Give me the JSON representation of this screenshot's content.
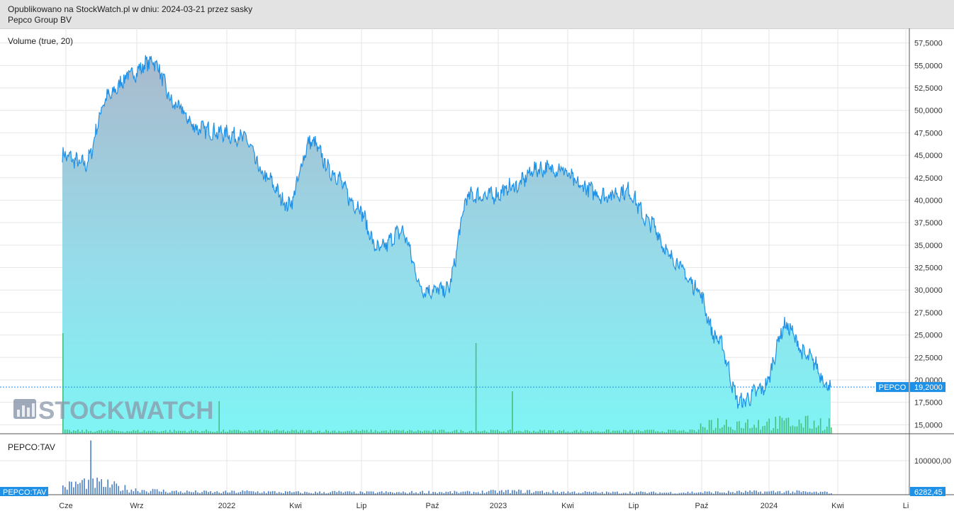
{
  "header": {
    "published_line": "Opublikowano na StockWatch.pl w dniu: 2024-03-21 przez sasky",
    "instrument": "Pepco Group BV"
  },
  "colors": {
    "price_line": "#1e90e6",
    "price_fill_top": "#a9b9cc",
    "price_fill_bottom": "#7ff4f4",
    "volume_bar": "#3db56a",
    "tav_bar": "#4a7fc1",
    "label_bg": "#1e90e6",
    "grid": "#e6e6e6"
  },
  "watermark": "STOCKWATCH",
  "chart_data": [
    {
      "type": "area",
      "indicator_label": "Volume (true, 20)",
      "series_label": "PEPCO",
      "last_value_label": "19,2000",
      "ylim": [
        14000,
        58500
      ],
      "y_ticks": [
        "57,5000",
        "55,0000",
        "52,5000",
        "50,0000",
        "47,5000",
        "45,0000",
        "42,5000",
        "40,0000",
        "37,5000",
        "35,0000",
        "32,5000",
        "30,0000",
        "27,5000",
        "25,0000",
        "22,5000",
        "20,0000",
        "17,5000",
        "15,0000"
      ],
      "x_ticks": [
        "Cze",
        "Wrz",
        "2022",
        "Kwi",
        "Lip",
        "Paź",
        "2023",
        "Kwi",
        "Lip",
        "Paź",
        "2024",
        "Kwi",
        "Li"
      ],
      "x": [
        "2021-05",
        "2021-06",
        "2021-07",
        "2021-08",
        "2021-09",
        "2021-10",
        "2021-11",
        "2021-12",
        "2022-01",
        "2022-02",
        "2022-03",
        "2022-04",
        "2022-05",
        "2022-06",
        "2022-07",
        "2022-08",
        "2022-09",
        "2022-10",
        "2022-11",
        "2022-12",
        "2023-01",
        "2023-02",
        "2023-03",
        "2023-04",
        "2023-05",
        "2023-06",
        "2023-07",
        "2023-08",
        "2023-09",
        "2023-10",
        "2023-11",
        "2023-12",
        "2024-01",
        "2024-02",
        "2024-03"
      ],
      "values": [
        45.0,
        44.0,
        51.5,
        54.0,
        55.5,
        50.5,
        48.0,
        47.5,
        47.0,
        42.5,
        39.5,
        46.5,
        43.0,
        39.5,
        34.5,
        36.5,
        30.0,
        30.0,
        40.5,
        40.5,
        41.5,
        43.5,
        43.5,
        41.5,
        40.5,
        41.0,
        37.5,
        33.5,
        30.5,
        24.5,
        17.5,
        19.0,
        26.0,
        22.5,
        19.2
      ]
    },
    {
      "type": "bar",
      "series_label": "PEPCO:TAV",
      "panel_label": "PEPCO:TAV",
      "last_value_label": "6282,45",
      "y_ticks": [
        "100000,00"
      ],
      "values": [
        22000,
        36000,
        28000,
        15000,
        12000,
        9000,
        8000,
        7000,
        9000,
        8000,
        7000,
        6000,
        8000,
        6000,
        7000,
        6000,
        8000,
        7000,
        7000,
        9000,
        10000,
        9000,
        8000,
        7000,
        6000,
        7000,
        6000,
        6000,
        7000,
        7000,
        8000,
        8000,
        9000,
        7000,
        6282
      ]
    }
  ]
}
